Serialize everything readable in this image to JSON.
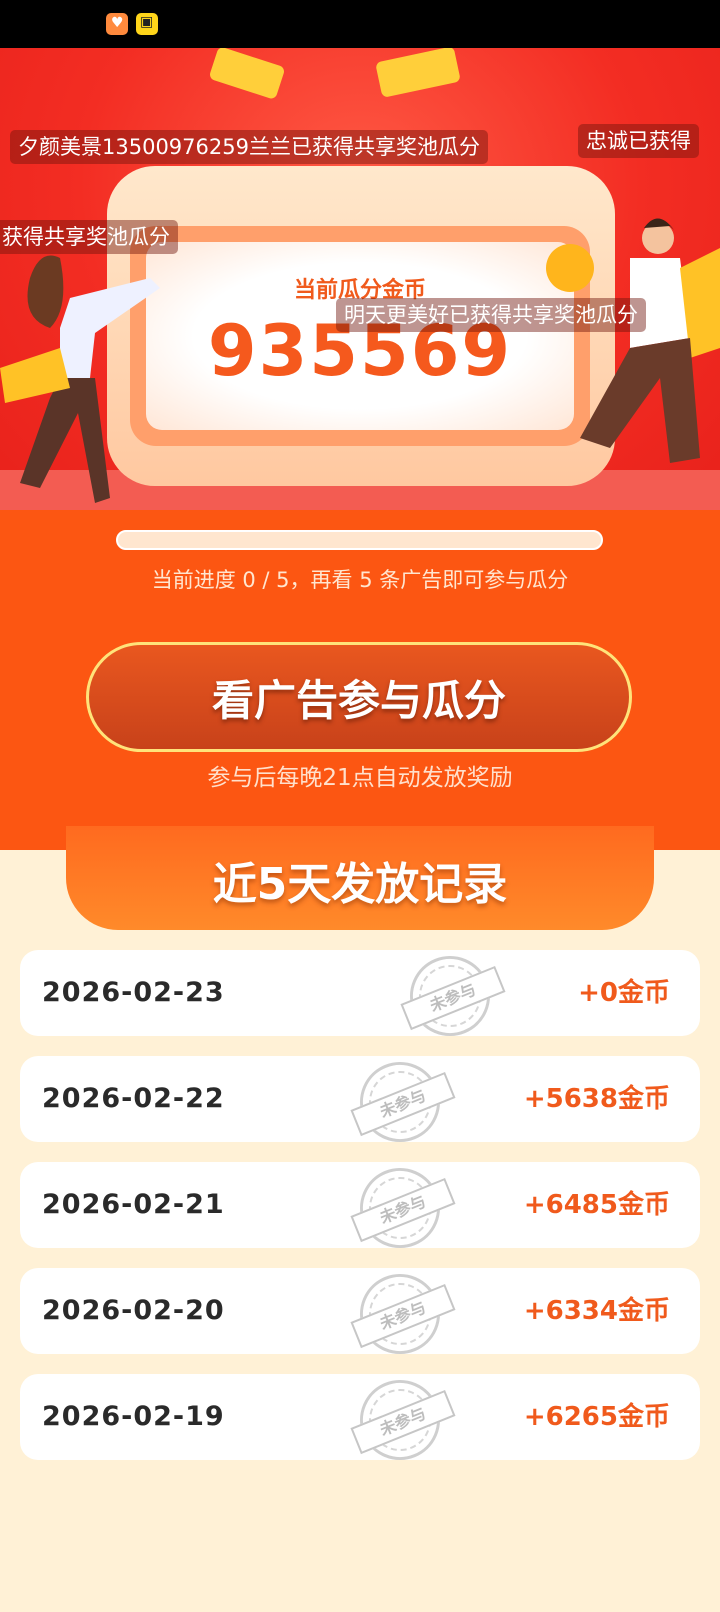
{
  "status_bar": {
    "icons": [
      "app-icon-orange-heart",
      "app-icon-yellow"
    ]
  },
  "hero": {
    "coin_label": "当前瓜分金币",
    "coin_value": "935569",
    "danmu": [
      "夕颜美景13500976259兰兰已获得共享奖池瓜分",
      "忠诚已获得",
      "获得共享奖池瓜分",
      "明天更美好已获得共享奖池瓜分"
    ]
  },
  "progress": {
    "current": 0,
    "total": 5,
    "text": "当前进度 0 / 5，再看 5 条广告即可参与瓜分"
  },
  "cta": {
    "label": "看广告参与瓜分",
    "subtext": "参与后每晚21点自动发放奖励"
  },
  "records": {
    "title": "近5天发放记录",
    "stamp_text": "未参与",
    "rows": [
      {
        "date": "2026-02-23",
        "amount": "+0金币"
      },
      {
        "date": "2026-02-22",
        "amount": "+5638金币"
      },
      {
        "date": "2026-02-21",
        "amount": "+6485金币"
      },
      {
        "date": "2026-02-20",
        "amount": "+6334金币"
      },
      {
        "date": "2026-02-19",
        "amount": "+6265金币"
      }
    ]
  },
  "colors": {
    "accent": "#fc5612",
    "amount": "#f05a1c",
    "background": "#fff1d6"
  }
}
